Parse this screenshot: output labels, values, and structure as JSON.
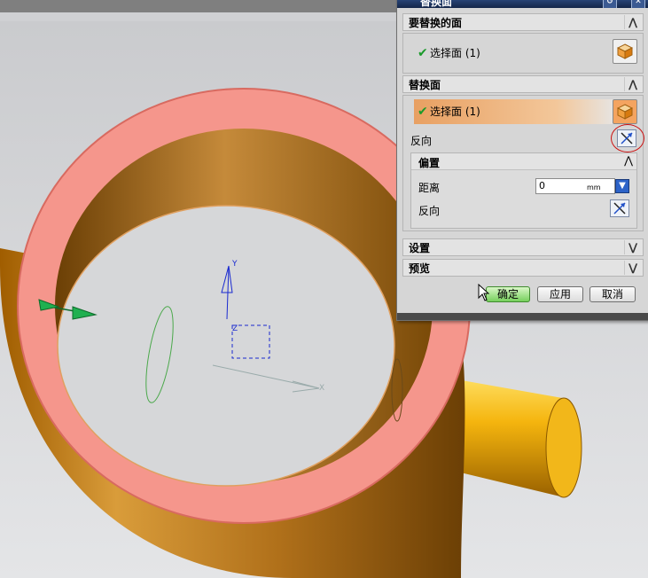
{
  "dialog": {
    "title": "替换面",
    "section_target": {
      "header": "要替换的面",
      "selection_label": "选择面 (1)"
    },
    "section_replace": {
      "header": "替换面",
      "selection_label": "选择面 (1)",
      "reverse_label": "反向"
    },
    "offset": {
      "header": "偏置",
      "distance_label": "距离",
      "distance_value": "0",
      "distance_unit": "mm",
      "reverse_label": "反向"
    },
    "section_settings": {
      "header": "设置"
    },
    "section_preview": {
      "header": "预览"
    },
    "buttons": {
      "ok": "确定",
      "apply": "应用",
      "cancel": "取消"
    }
  },
  "annotation": {
    "text": "反向",
    "color": "#cc1111"
  },
  "viewport": {
    "axis_labels": {
      "y": "Y",
      "z": "Z",
      "x": "X"
    }
  },
  "colors": {
    "face_highlight": "#f6928a",
    "body": "#c07810",
    "pipe": "#f5c018",
    "accent_selected": "#f0b078"
  }
}
